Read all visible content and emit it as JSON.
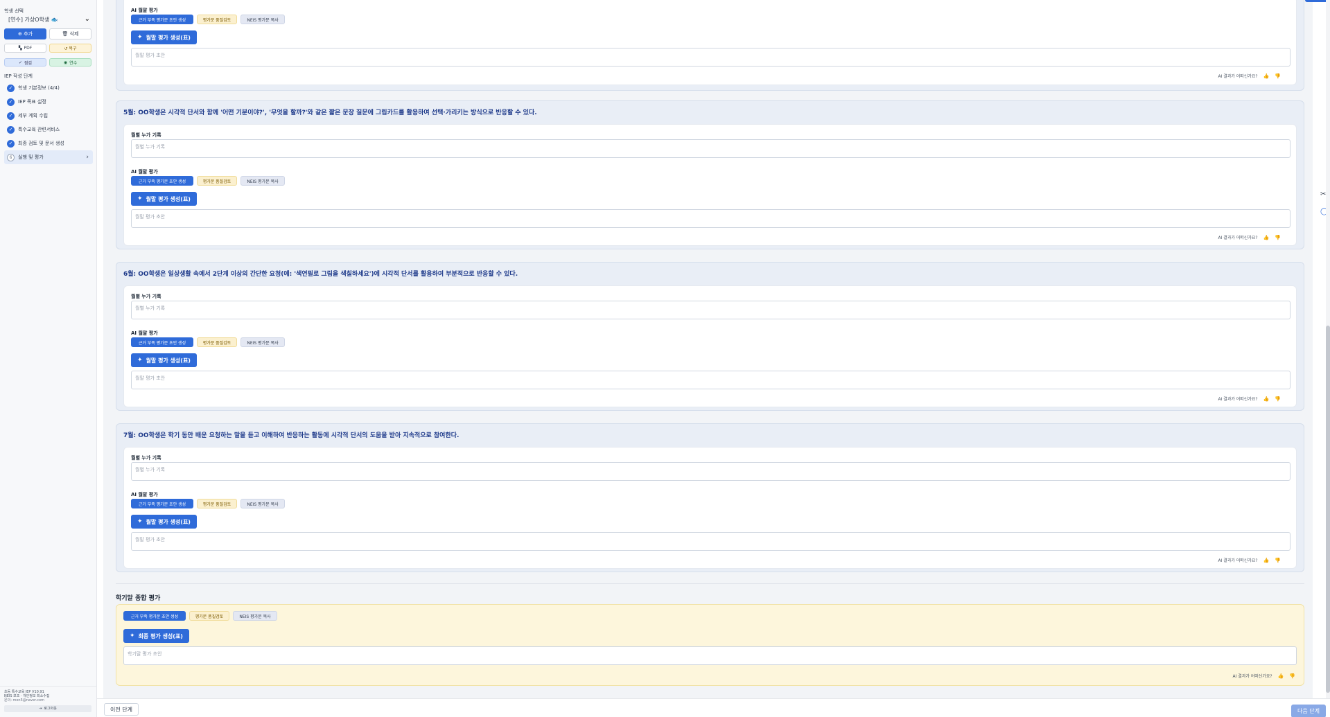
{
  "sidebar": {
    "student_select_label": "학생 선택",
    "student_value": "[연수] 가상O학생 🐟",
    "add_label": "⊕ 추가",
    "delete_label": "🗑 삭제",
    "pdf_label": "PDF",
    "restore_label": "↺ 복구",
    "check_label": "점검",
    "train_label": "연수",
    "steps_heading": "IEP 작성 단계",
    "steps": [
      {
        "label": "학생 기본정보 (4/4)",
        "done": true
      },
      {
        "label": "IEP 목표 설정",
        "done": true
      },
      {
        "label": "세부 계획 수립",
        "done": true
      },
      {
        "label": "특수교육 관련서비스",
        "done": true
      },
      {
        "label": "최종 검토 및 문서 생성",
        "done": true
      },
      {
        "label": "실행 및 평가",
        "done": false,
        "number": "6",
        "active": true
      }
    ],
    "footer": {
      "version": "초등 특수교육 IEP V10.91",
      "privacy": "NEIS 보조 · 개인정보 최소수집",
      "contact": "문의: mon5@naver.com",
      "logout": "로그아웃"
    }
  },
  "common": {
    "monthly_record_label": "월별 누가 기록",
    "monthly_record_placeholder": "월별 누가 기록",
    "ai_eval_label": "AI 월말 평가",
    "tag_generate": "근거 부족 평가문 초안 생성",
    "tag_review": "평가문 품질검토",
    "tag_neis": "NEIS 평가문 복사",
    "gen_button": "월말 평가 생성(표)",
    "eval_placeholder": "월말 평가 초안",
    "feedback_question": "AI 결과가 어떠신가요?"
  },
  "months": [
    {
      "title": "5월: OO학생은 시각적 단서와 함께 '어떤 기분이야?', '무엇을 할까?'와 같은 짧은 문장 질문에 그림카드를 활용하여 선택·가리키는 방식으로 반응할 수 있다."
    },
    {
      "title": "6월: OO학생은 일상생활 속에서 2단계 이상의 간단한 요청(예: '색연필로 그림을 색칠하세요')에 시각적 단서를 활용하여 부분적으로 반응할 수 있다."
    },
    {
      "title": "7월: OO학생은 학기 동안 배운 요청하는 말을 듣고 이해하여 반응하는 활동에 시각적 단서의 도움을 받아 지속적으로 참여한다."
    }
  ],
  "final": {
    "title": "학기말 종합 평가",
    "gen_button": "최종 평가 생성(표)",
    "placeholder": "학기말 평가 초안"
  },
  "nav": {
    "prev": "이전 단계",
    "next": "다음 단계"
  }
}
